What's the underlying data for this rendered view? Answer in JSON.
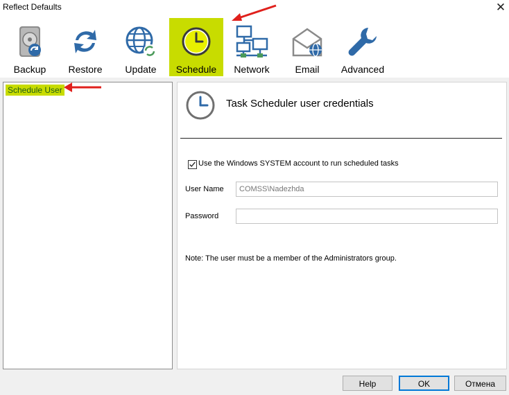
{
  "window": {
    "title": "Reflect Defaults",
    "close_glyph": "✕"
  },
  "toolbar": {
    "items": [
      {
        "label": "Backup",
        "icon": "backup-icon"
      },
      {
        "label": "Restore",
        "icon": "restore-icon"
      },
      {
        "label": "Update",
        "icon": "update-icon"
      },
      {
        "label": "Schedule",
        "icon": "schedule-icon",
        "active": true
      },
      {
        "label": "Network",
        "icon": "network-icon"
      },
      {
        "label": "Email",
        "icon": "email-icon"
      },
      {
        "label": "Advanced",
        "icon": "advanced-icon"
      }
    ]
  },
  "tree": {
    "items": [
      {
        "label": "Schedule User",
        "selected": true
      }
    ]
  },
  "panel": {
    "title": "Task Scheduler user credentials",
    "use_system_account": {
      "label": "Use the Windows SYSTEM account to run scheduled tasks",
      "checked": true,
      "check_glyph": "✓"
    },
    "user_name": {
      "label": "User Name",
      "value": "COMSS\\Nadezhda"
    },
    "password": {
      "label": "Password",
      "value": ""
    },
    "note": "Note: The user must be a member of the Administrators group."
  },
  "buttons": {
    "help": "Help",
    "ok": "OK",
    "cancel": "Отмена"
  },
  "colors": {
    "accent": "#c8dc00",
    "icon_blue": "#2f6aa8",
    "arrow_red": "#e0201c"
  }
}
